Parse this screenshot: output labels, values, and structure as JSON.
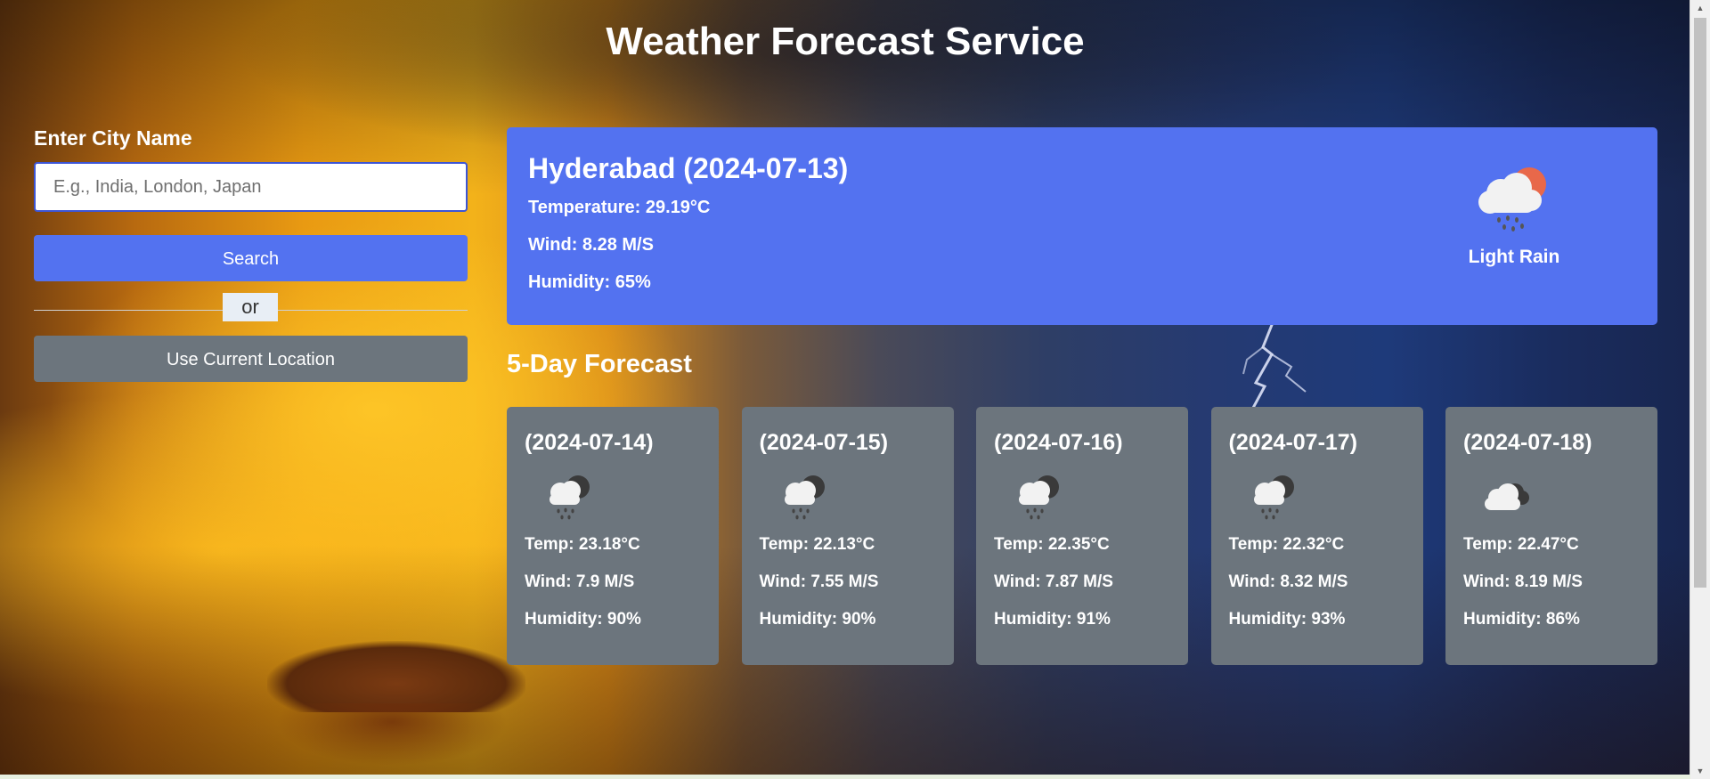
{
  "header": {
    "title": "Weather Forecast Service"
  },
  "search": {
    "label": "Enter City Name",
    "placeholder": "E.g., India, London, Japan",
    "value": "",
    "search_button": "Search",
    "divider_text": "or",
    "location_button": "Use Current Location"
  },
  "current": {
    "title": "Hyderabad (2024-07-13)",
    "temperature": "Temperature: 29.19°C",
    "wind": "Wind: 8.28 M/S",
    "humidity": "Humidity: 65%",
    "description": "Light Rain",
    "icon": "light-rain-sun-icon"
  },
  "forecast": {
    "heading": "5-Day Forecast",
    "days": [
      {
        "date": "(2024-07-14)",
        "temp": "Temp: 23.18°C",
        "wind": "Wind: 7.9 M/S",
        "humidity": "Humidity: 90%",
        "icon": "rain-night-icon"
      },
      {
        "date": "(2024-07-15)",
        "temp": "Temp: 22.13°C",
        "wind": "Wind: 7.55 M/S",
        "humidity": "Humidity: 90%",
        "icon": "rain-night-icon"
      },
      {
        "date": "(2024-07-16)",
        "temp": "Temp: 22.35°C",
        "wind": "Wind: 7.87 M/S",
        "humidity": "Humidity: 91%",
        "icon": "rain-night-icon"
      },
      {
        "date": "(2024-07-17)",
        "temp": "Temp: 22.32°C",
        "wind": "Wind: 8.32 M/S",
        "humidity": "Humidity: 93%",
        "icon": "rain-night-icon"
      },
      {
        "date": "(2024-07-18)",
        "temp": "Temp: 22.47°C",
        "wind": "Wind: 8.19 M/S",
        "humidity": "Humidity: 86%",
        "icon": "broken-clouds-icon"
      }
    ]
  },
  "colors": {
    "primary": "#5372f0",
    "secondary": "#6c757d",
    "text": "#ffffff"
  }
}
